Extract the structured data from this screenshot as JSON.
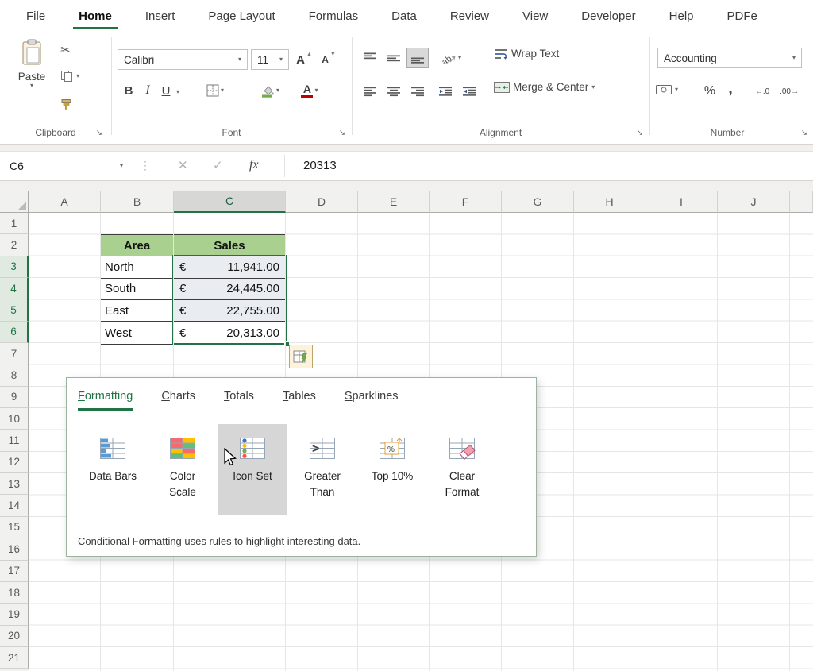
{
  "icons": {
    "dropdown": "▾",
    "cut": "✂",
    "dialog_launcher": "↘",
    "dots": "⋮",
    "cancel": "✕",
    "enter": "✓",
    "increase_decimal": "←.0",
    "decrease_decimal": ".00→"
  },
  "ribbon": {
    "tabs": [
      {
        "label": "File"
      },
      {
        "label": "Home",
        "active": true
      },
      {
        "label": "Insert"
      },
      {
        "label": "Page Layout"
      },
      {
        "label": "Formulas"
      },
      {
        "label": "Data"
      },
      {
        "label": "Review"
      },
      {
        "label": "View"
      },
      {
        "label": "Developer"
      },
      {
        "label": "Help"
      },
      {
        "label": "PDFe"
      }
    ],
    "clipboard": {
      "group_label": "Clipboard",
      "paste_label": "Paste"
    },
    "font": {
      "group_label": "Font",
      "font_name": "Calibri",
      "font_size": "11",
      "bold": "B",
      "italic": "I",
      "underline": "U"
    },
    "alignment": {
      "group_label": "Alignment",
      "wrap_text_label": "Wrap Text",
      "merge_center_label": "Merge & Center"
    },
    "number": {
      "group_label": "Number",
      "format_selected": "Accounting",
      "percent": "%",
      "comma": ","
    }
  },
  "formula_bar": {
    "name_box": "C6",
    "fx_label": "fx",
    "value": "20313"
  },
  "sheet": {
    "columns": [
      "A",
      "B",
      "C",
      "D",
      "E",
      "F",
      "G",
      "H",
      "I",
      "J"
    ],
    "selected_column": "C",
    "row_count": 21,
    "selected_rows": [
      3,
      4,
      5,
      6
    ],
    "active_cell": "C6",
    "table": {
      "header": [
        "Area",
        "Sales"
      ],
      "header_fill": "#A9D08E",
      "rows": [
        {
          "area": "North",
          "cur": "€",
          "amount": "11,941.00"
        },
        {
          "area": "South",
          "cur": "€",
          "amount": "24,445.00"
        },
        {
          "area": "East",
          "cur": "€",
          "amount": "22,755.00"
        },
        {
          "area": "West",
          "cur": "€",
          "amount": "20,313.00"
        }
      ]
    }
  },
  "quick_analysis": {
    "tabs": [
      {
        "label": "Formatting",
        "active": true
      },
      {
        "label": "Charts"
      },
      {
        "label": "Totals"
      },
      {
        "label": "Tables"
      },
      {
        "label": "Sparklines"
      }
    ],
    "items": [
      {
        "label": "Data Bars",
        "icon": "data-bars"
      },
      {
        "label": "Color Scale",
        "icon": "color-scale"
      },
      {
        "label": "Icon Set",
        "icon": "icon-set",
        "hovered": true
      },
      {
        "label": "Greater Than",
        "icon": "greater-than"
      },
      {
        "label": "Top 10%",
        "icon": "top-10"
      },
      {
        "label": "Clear Format",
        "icon": "clear-format"
      }
    ],
    "footer": "Conditional Formatting uses rules to highlight interesting data."
  },
  "colors": {
    "accent_green": "#217346",
    "table_header_green": "#A9D08E",
    "selection_border": "#217346"
  }
}
